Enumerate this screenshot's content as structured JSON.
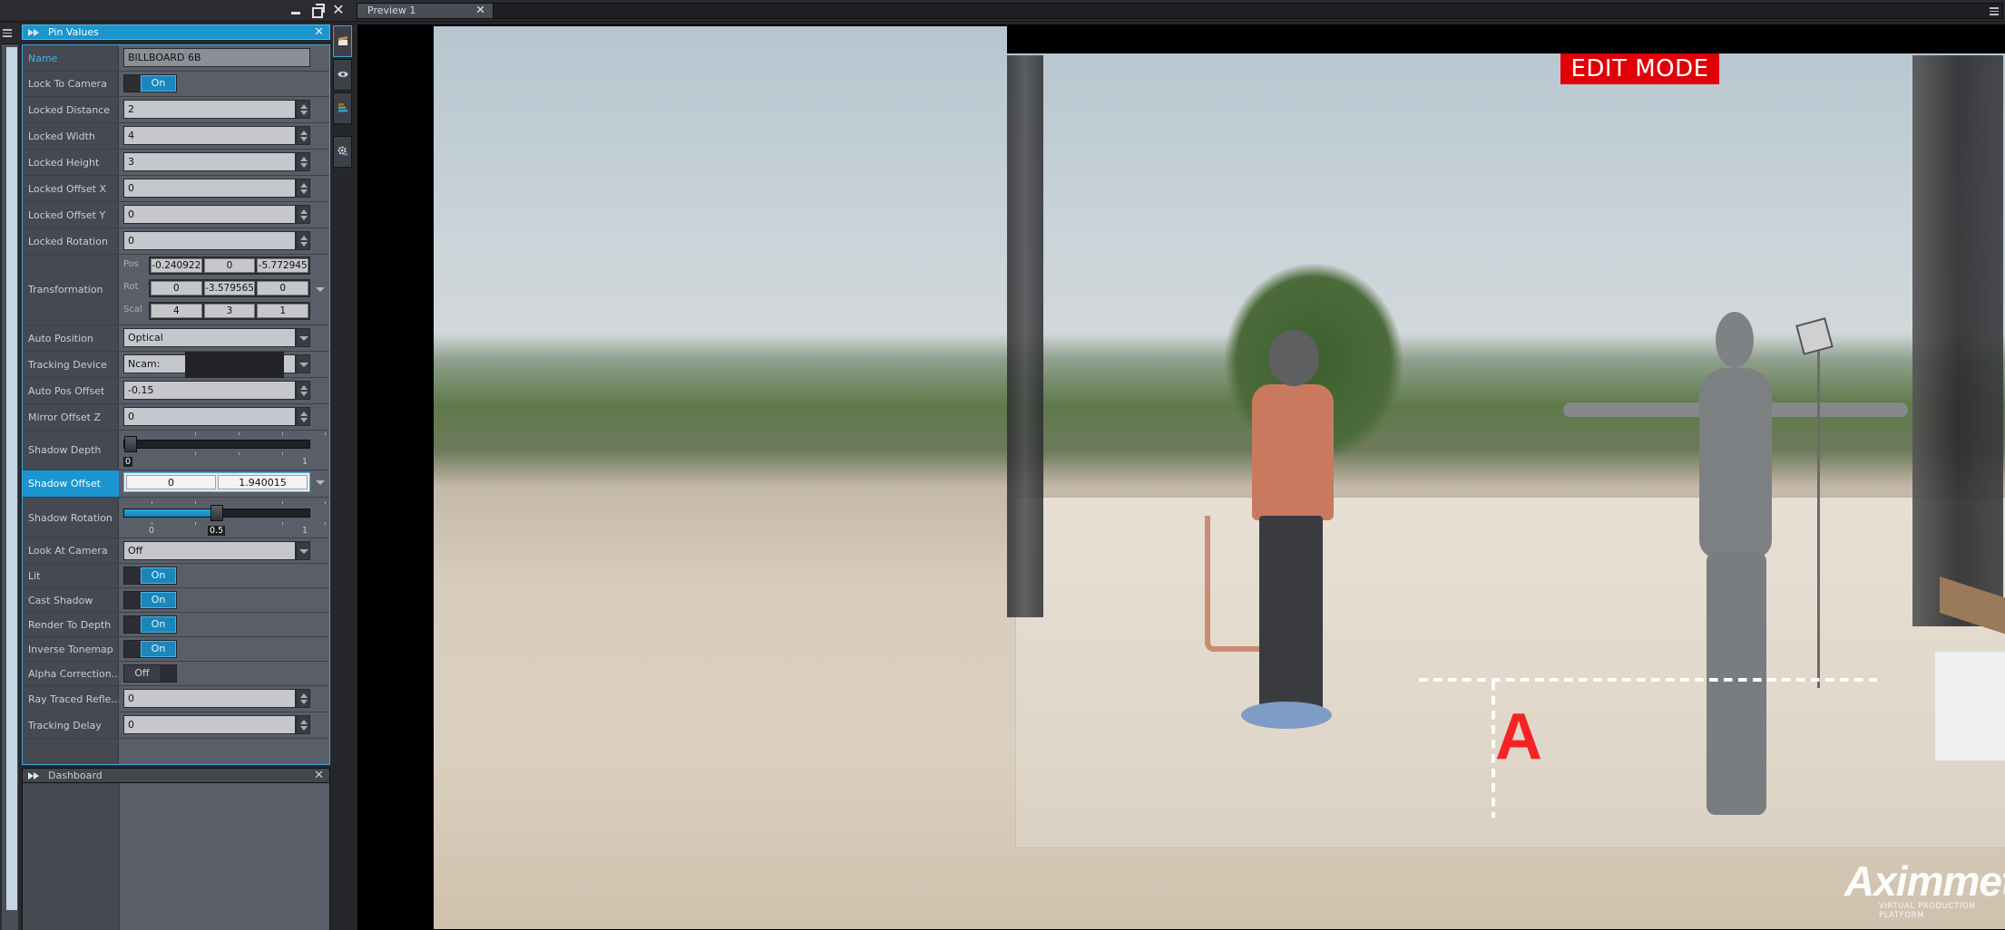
{
  "window": {
    "controls": {
      "minimize": "minimize-icon",
      "maximize": "restore-icon",
      "close": "close-icon"
    }
  },
  "tabs": [
    {
      "label": "Preview 1",
      "close_icon": "close-icon",
      "active": true
    }
  ],
  "pin_values": {
    "title": "Pin Values",
    "close_glyph": "✕",
    "rows": {
      "name": {
        "label": "Name",
        "value": "BILLBOARD 6B"
      },
      "lock_to_camera": {
        "label": "Lock To Camera",
        "value": "On"
      },
      "locked_distance": {
        "label": "Locked Distance",
        "value": "2"
      },
      "locked_width": {
        "label": "Locked Width",
        "value": "4"
      },
      "locked_height": {
        "label": "Locked Height",
        "value": "3"
      },
      "locked_offset_x": {
        "label": "Locked Offset X",
        "value": "0"
      },
      "locked_offset_y": {
        "label": "Locked Offset Y",
        "value": "0"
      },
      "locked_rotation": {
        "label": "Locked Rotation",
        "value": "0"
      },
      "transformation": {
        "label": "Transformation",
        "pos_label": "Pos",
        "pos": [
          "-0.240922",
          "0",
          "-5.772945"
        ],
        "rot_label": "Rot",
        "rot": [
          "0",
          "-3.579565",
          "0"
        ],
        "scal_label": "Scal",
        "scal": [
          "4",
          "3",
          "1"
        ]
      },
      "auto_position": {
        "label": "Auto Position",
        "value": "Optical"
      },
      "tracking_device": {
        "label": "Tracking Device",
        "value": "Ncam:"
      },
      "auto_pos_offset": {
        "label": "Auto Pos Offset",
        "value": "-0.15"
      },
      "mirror_offset_z": {
        "label": "Mirror Offset Z",
        "value": "0"
      },
      "shadow_depth": {
        "label": "Shadow Depth",
        "value": 0,
        "min": "0",
        "max": "1",
        "current_label": "0"
      },
      "shadow_offset": {
        "label": "Shadow Offset",
        "values": [
          "0",
          "1.940015"
        ]
      },
      "shadow_rotation": {
        "label": "Shadow Rotation",
        "value": 0.5,
        "min": "0",
        "max": "1",
        "current_label": "0.5"
      },
      "look_at_camera": {
        "label": "Look At Camera",
        "value": "Off"
      },
      "lit": {
        "label": "Lit",
        "value": "On"
      },
      "cast_shadow": {
        "label": "Cast Shadow",
        "value": "On"
      },
      "render_to_depth": {
        "label": "Render To Depth",
        "value": "On"
      },
      "inverse_tonemap": {
        "label": "Inverse Tonemap",
        "value": "On"
      },
      "alpha_correction": {
        "label": "Alpha Correction...",
        "value": "Off"
      },
      "ray_traced_reflections": {
        "label": "Ray Traced Refle...",
        "value": "0"
      },
      "tracking_delay": {
        "label": "Tracking Delay",
        "value": "0"
      }
    }
  },
  "dashboard": {
    "title": "Dashboard",
    "close_glyph": "✕"
  },
  "toolbar_icons": [
    "clapperboard-icon",
    "eye-icon",
    "layers-icon",
    "settings-icon"
  ],
  "viewport": {
    "badge": "EDIT MODE",
    "badge_color": "#e00008",
    "marker_label": "A",
    "marker_color": "#f52424",
    "logo_wordmark": "Aximmetry",
    "logo_tagline": "VIRTUAL PRODUCTION PLATFORM"
  },
  "accent_color": "#1996cf"
}
